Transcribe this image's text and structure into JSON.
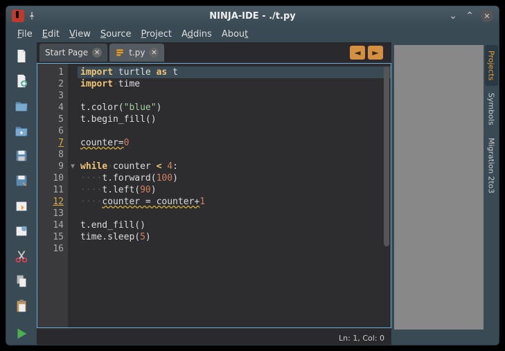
{
  "window": {
    "title": "NINJA-IDE - ./t.py"
  },
  "menu": {
    "file": "FFile",
    "edit": "EEdit",
    "view": "VView",
    "source": "SSource",
    "project": "PProject",
    "addins": "AAddins",
    "about": "AAbout"
  },
  "tabs": [
    {
      "label": "Start Page",
      "active": false,
      "hasIcon": false
    },
    {
      "label": "t.py",
      "active": true,
      "hasIcon": true
    }
  ],
  "editor": {
    "lineCount": 16,
    "warnLines": [
      7,
      12
    ],
    "foldArrowLine": 9,
    "currentLine": 1,
    "lines": [
      {
        "n": 1,
        "tokens": [
          {
            "t": "import",
            "c": "kw"
          },
          {
            "t": "·",
            "c": "ws"
          },
          {
            "t": "turtle "
          },
          {
            "t": "as",
            "c": "kw"
          },
          {
            "t": "·",
            "c": "ws"
          },
          {
            "t": "t"
          }
        ]
      },
      {
        "n": 2,
        "tokens": [
          {
            "t": "import",
            "c": "kw"
          },
          {
            "t": "·",
            "c": "ws"
          },
          {
            "t": "time"
          }
        ]
      },
      {
        "n": 3,
        "tokens": []
      },
      {
        "n": 4,
        "tokens": [
          {
            "t": "t.color("
          },
          {
            "t": "\"blue\"",
            "c": "str"
          },
          {
            "t": ")"
          }
        ]
      },
      {
        "n": 5,
        "tokens": [
          {
            "t": "t.begin_fill()"
          }
        ]
      },
      {
        "n": 6,
        "tokens": []
      },
      {
        "n": 7,
        "tokens": [
          {
            "t": "counter=",
            "c": "warn-u"
          },
          {
            "t": "0",
            "c": "num"
          }
        ]
      },
      {
        "n": 8,
        "tokens": []
      },
      {
        "n": 9,
        "tokens": [
          {
            "t": "while",
            "c": "kw"
          },
          {
            "t": "·",
            "c": "ws"
          },
          {
            "t": "counter "
          },
          {
            "t": "<",
            "c": "kw"
          },
          {
            "t": " "
          },
          {
            "t": "4",
            "c": "num"
          },
          {
            "t": ":"
          }
        ]
      },
      {
        "n": 10,
        "tokens": [
          {
            "t": "····",
            "c": "ws"
          },
          {
            "t": "t.forward("
          },
          {
            "t": "100",
            "c": "num"
          },
          {
            "t": ")"
          }
        ]
      },
      {
        "n": 11,
        "tokens": [
          {
            "t": "····",
            "c": "ws"
          },
          {
            "t": "t.left("
          },
          {
            "t": "90",
            "c": "num"
          },
          {
            "t": ")"
          }
        ]
      },
      {
        "n": 12,
        "tokens": [
          {
            "t": "····",
            "c": "ws"
          },
          {
            "t": "counter = counter+",
            "c": "warn-u"
          },
          {
            "t": "1",
            "c": "num"
          }
        ]
      },
      {
        "n": 13,
        "tokens": []
      },
      {
        "n": 14,
        "tokens": [
          {
            "t": "t.end_fill()"
          }
        ]
      },
      {
        "n": 15,
        "tokens": [
          {
            "t": "time.sleep("
          },
          {
            "t": "5",
            "c": "num"
          },
          {
            "t": ")"
          }
        ]
      },
      {
        "n": 16,
        "tokens": []
      }
    ]
  },
  "status": {
    "pos": "Ln: 1, Col: 0"
  },
  "dock": {
    "tabs": [
      {
        "label": "Projects",
        "active": true
      },
      {
        "label": "Symbols",
        "active": false
      },
      {
        "label": "Migration 2to3",
        "active": false
      }
    ]
  }
}
